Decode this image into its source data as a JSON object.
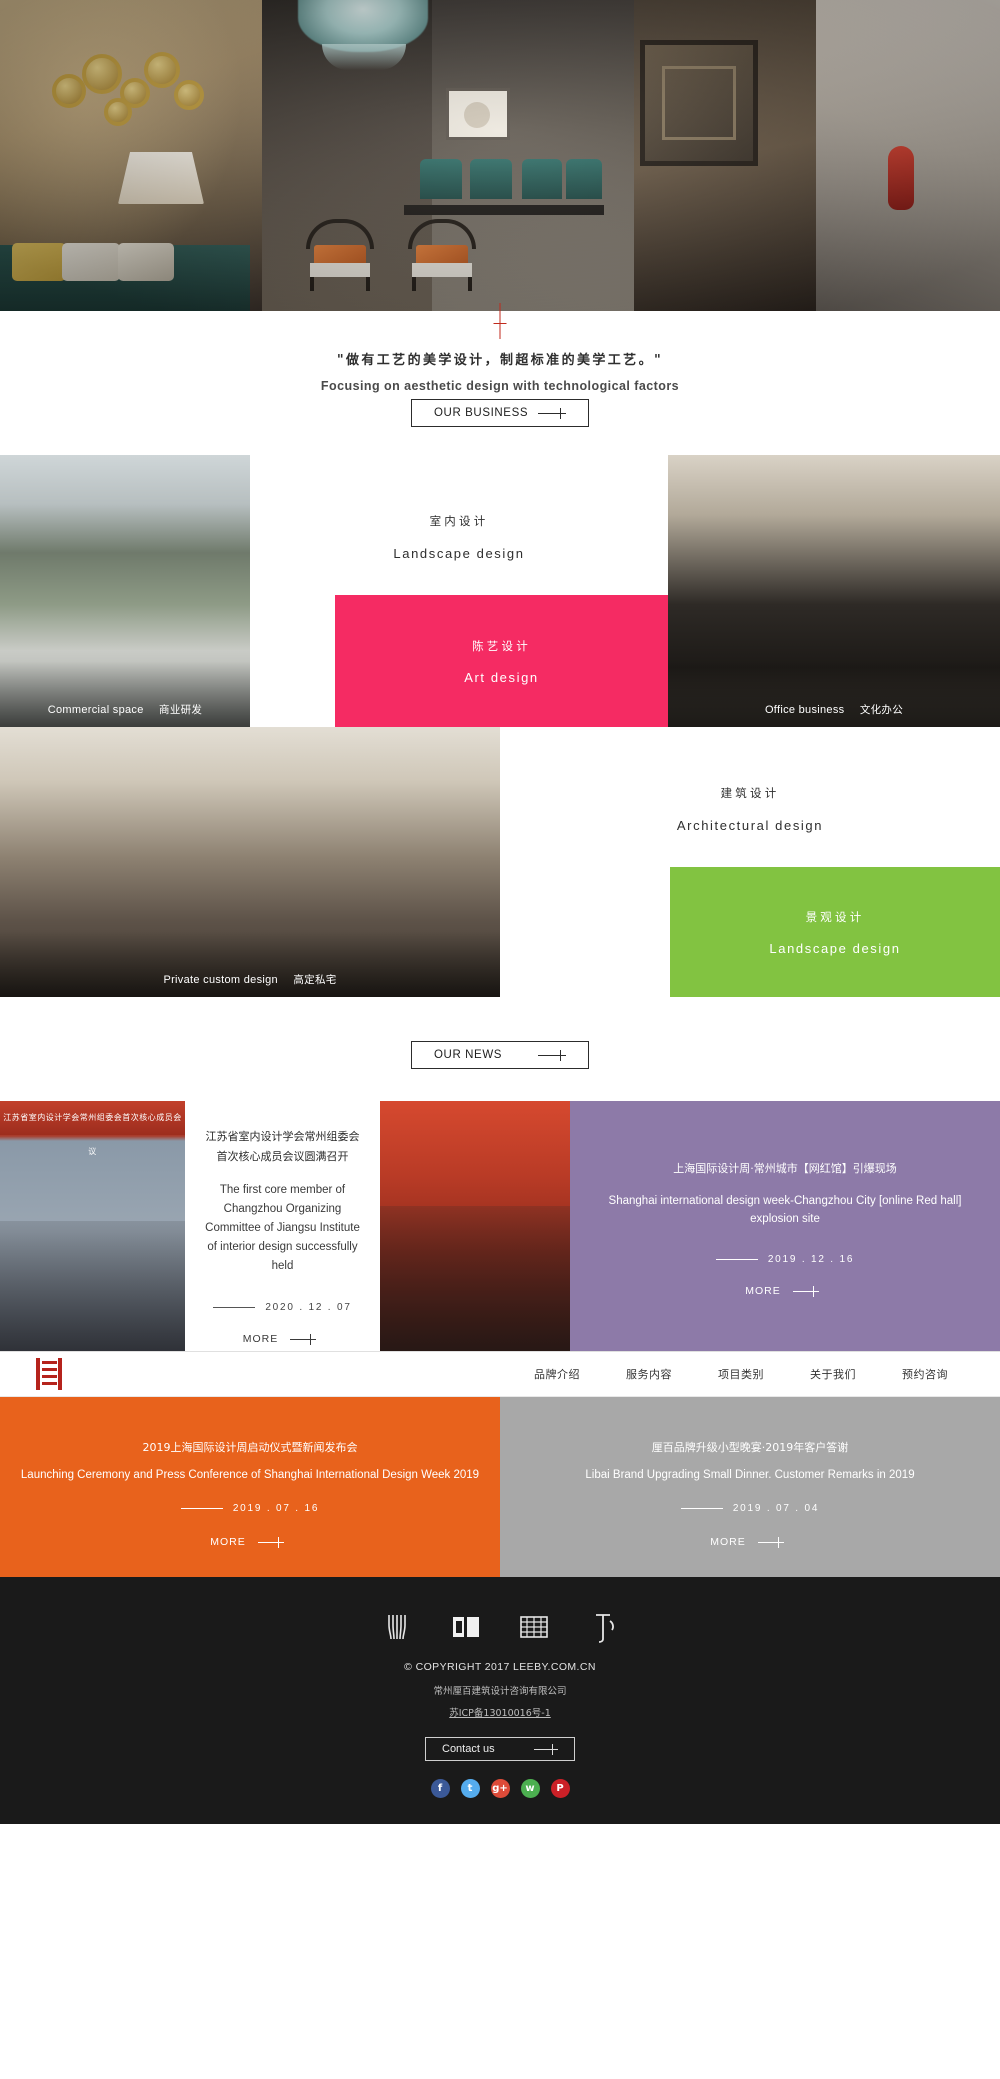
{
  "hero": {
    "alt": "luxury chinese style interior lounge"
  },
  "tagline": {
    "cn": "\"做有工艺的美学设计，制超标准的美学工艺。\"",
    "en": "Focusing on aesthetic design with technological factors"
  },
  "sections": {
    "business_button": "OUR BUSINESS",
    "news_button": "OUR NEWS"
  },
  "business": {
    "cells": [
      {
        "cn": "商业研发",
        "en": "Commercial space",
        "type": "photo"
      },
      {
        "cn": "室内设计",
        "en": "Landscape design",
        "type": "text"
      },
      {
        "cn": "文化办公",
        "en": "Office business",
        "type": "photo"
      },
      {
        "cn": "陈艺设计",
        "en": "Art design",
        "type": "color",
        "color": "#f52b63"
      },
      {
        "cn": "高定私宅",
        "en": "Private custom design",
        "type": "photo"
      },
      {
        "cn": "建筑设计",
        "en": "Architectural design",
        "type": "text"
      },
      {
        "cn": "景观设计",
        "en": "Landscape design",
        "type": "color",
        "color": "#82c341"
      }
    ]
  },
  "news": [
    {
      "image_caption": "江苏省室内设计学会常州组委会首次核心成员会议",
      "cn": "江苏省室内设计学会常州组委会首次核心成员会议圆满召开",
      "en": "The first core member of Changzhou Organizing Committee of Jiangsu Institute of interior design successfully held",
      "date": "2020 . 12 . 07",
      "more": "MORE"
    },
    {
      "cn": "上海国际设计周·常州城市【网红馆】引爆现场",
      "en": "Shanghai international design week-Changzhou City [online Red hall] explosion site",
      "date": "2019 . 12 . 16",
      "more": "MORE"
    }
  ],
  "nav": {
    "links": [
      "品牌介绍",
      "服务内容",
      "项目类别",
      "关于我们",
      "预约咨询"
    ]
  },
  "tiles": [
    {
      "cn": "2019上海国际设计周启动仪式暨新闻发布会",
      "en": "Launching Ceremony and Press Conference of Shanghai International Design Week 2019",
      "date": "2019 . 07 . 16",
      "more": "MORE",
      "color": "#e8621c"
    },
    {
      "cn": "厘百品牌升级小型晚宴·2019年客户答谢",
      "en": "Libai Brand Upgrading Small Dinner. Customer Remarks in 2019",
      "date": "2019 . 07 . 04",
      "more": "MORE",
      "color": "#a8a8a8"
    }
  ],
  "footer": {
    "icons": [
      "tools-icon",
      "book-icon",
      "ledger-icon",
      "brush-icon"
    ],
    "copyright": "© COPYRIGHT 2017 LEEBY.COM.CN",
    "company": "常州厘百建筑设计咨询有限公司",
    "icp": "苏ICP备13010016号-1",
    "contact_label": "Contact us",
    "socials": [
      {
        "name": "facebook-icon",
        "glyph": "f",
        "color": "#3b5998"
      },
      {
        "name": "twitter-icon",
        "glyph": "t",
        "color": "#55acee"
      },
      {
        "name": "google-plus-icon",
        "glyph": "g+",
        "color": "#dd4b39"
      },
      {
        "name": "wechat-icon",
        "glyph": "w",
        "color": "#4caf50"
      },
      {
        "name": "pinterest-icon",
        "glyph": "P",
        "color": "#cb2027"
      }
    ]
  }
}
